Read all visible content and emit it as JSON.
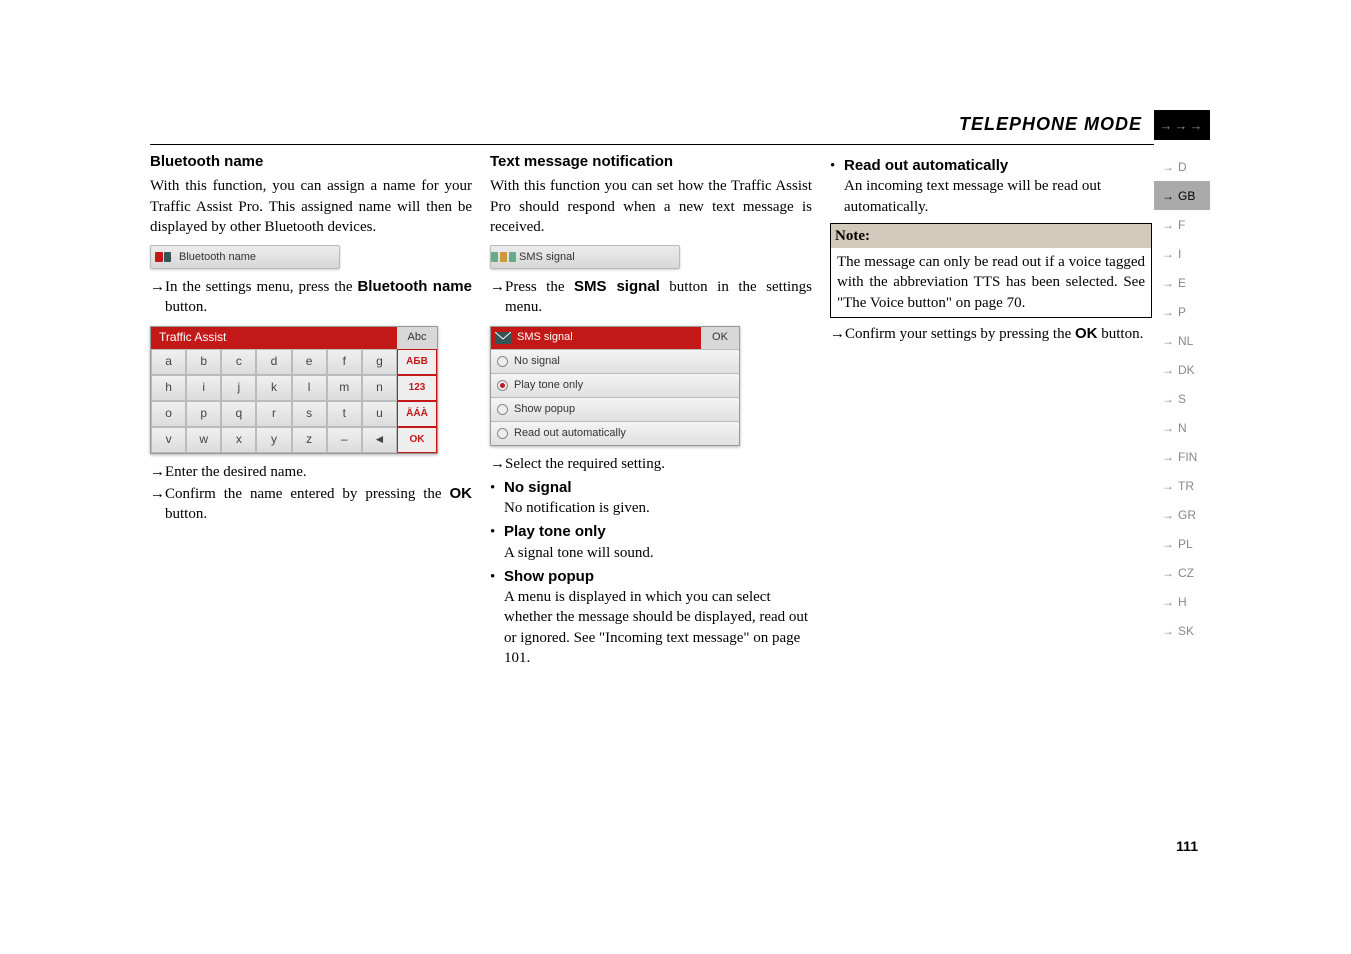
{
  "header": {
    "mode_title": "TELEPHONE MODE",
    "arrows": "→→→"
  },
  "col1": {
    "heading": "Bluetooth name",
    "p1": "With this function, you can assign a name for your Traffic Assist Pro. This assigned name will then be displayed by other Bluetooth devices.",
    "btn_label": "Bluetooth name",
    "step1": "In the settings menu, press the ",
    "step1_bold": "Bluetooth name",
    "step1_tail": " button.",
    "kb_title": "Traffic Assist",
    "kb_abc": "Abc",
    "kb_rows": [
      [
        "a",
        "b",
        "c",
        "d",
        "e",
        "f",
        "g"
      ],
      [
        "h",
        "i",
        "j",
        "k",
        "l",
        "m",
        "n"
      ],
      [
        "o",
        "p",
        "q",
        "r",
        "s",
        "t",
        "u"
      ],
      [
        "v",
        "w",
        "x",
        "y",
        "z",
        "–",
        "◄"
      ]
    ],
    "kb_side": [
      "АБВ",
      "123",
      "ÄÁÀ",
      "OK"
    ],
    "step2": "Enter the desired name.",
    "step3": "Confirm the name entered by pressing the ",
    "step3_bold": "OK",
    "step3_tail": " button."
  },
  "col2": {
    "heading": "Text message notification",
    "p1": "With this function you can set how the Traffic Assist Pro should respond when a new text message is received.",
    "sms_btn_label": "SMS signal",
    "step1a": "Press the ",
    "step1b": "SMS signal",
    "step1c": " button in the settings menu.",
    "panel_title": "SMS signal",
    "panel_ok": "OK",
    "panel_rows": [
      {
        "label": "No signal",
        "selected": false
      },
      {
        "label": "Play tone only",
        "selected": true
      },
      {
        "label": "Show popup",
        "selected": false
      },
      {
        "label": "Read out automatically",
        "selected": false
      }
    ],
    "step2": "Select the required setting.",
    "b1_title": "No signal",
    "b1_body": "No notification is given.",
    "b2_title": "Play tone only",
    "b2_body": "A signal tone will sound.",
    "b3_title": "Show popup",
    "b3_body": "A menu is displayed in which you can select whether the message should be displayed, read out or ignored. See \"Incoming text message\" on page 101."
  },
  "col3": {
    "b4_title": "Read out automatically",
    "b4_body": "An incoming text message will be read out automatically.",
    "note_title": "Note:",
    "note_body": "The message can only be read out if a voice tagged with the abbreviation TTS has been selected. See \"The Voice button\" on page 70.",
    "step1a": "Confirm your settings by pressing the ",
    "step1b": "OK",
    "step1c": " button."
  },
  "sidetabs": [
    "D",
    "GB",
    "F",
    "I",
    "E",
    "P",
    "NL",
    "DK",
    "S",
    "N",
    "FIN",
    "TR",
    "GR",
    "PL",
    "CZ",
    "H",
    "SK"
  ],
  "active_tab": "GB",
  "page_number": "111"
}
